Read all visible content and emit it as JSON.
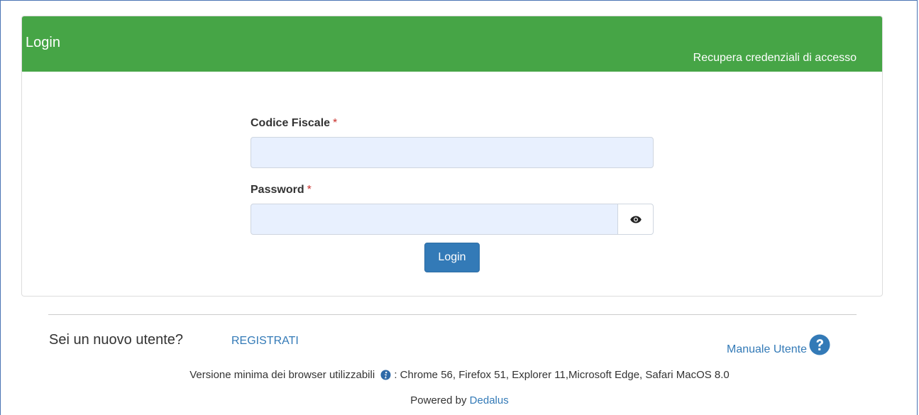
{
  "panel": {
    "title": "Login",
    "recover_link": "Recupera credenziali di accesso"
  },
  "form": {
    "codice_fiscale": {
      "label": "Codice Fiscale",
      "required_mark": "*",
      "value": ""
    },
    "password": {
      "label": "Password",
      "required_mark": "*",
      "value": ""
    },
    "toggle_icon": "eye-icon",
    "submit_label": "Login"
  },
  "footer": {
    "new_user_text": "Sei un nuovo utente?",
    "register_link": "REGISTRATI",
    "manual_link": "Manuale Utente",
    "help_icon": "question-circle-icon",
    "browser_prefix": "Versione minima dei browser utilizzabili",
    "info_icon": "info-circle-icon",
    "browser_list": ": Chrome 56, Firefox 51, Explorer 11,Microsoft Edge, Safari MacOS 8.0",
    "powered_prefix": "Powered by",
    "powered_link": "Dedalus"
  },
  "colors": {
    "header_green": "#46a546",
    "primary_blue": "#337ab7",
    "required_red": "#c9302c",
    "autofill_bg": "#e8f0fe"
  }
}
